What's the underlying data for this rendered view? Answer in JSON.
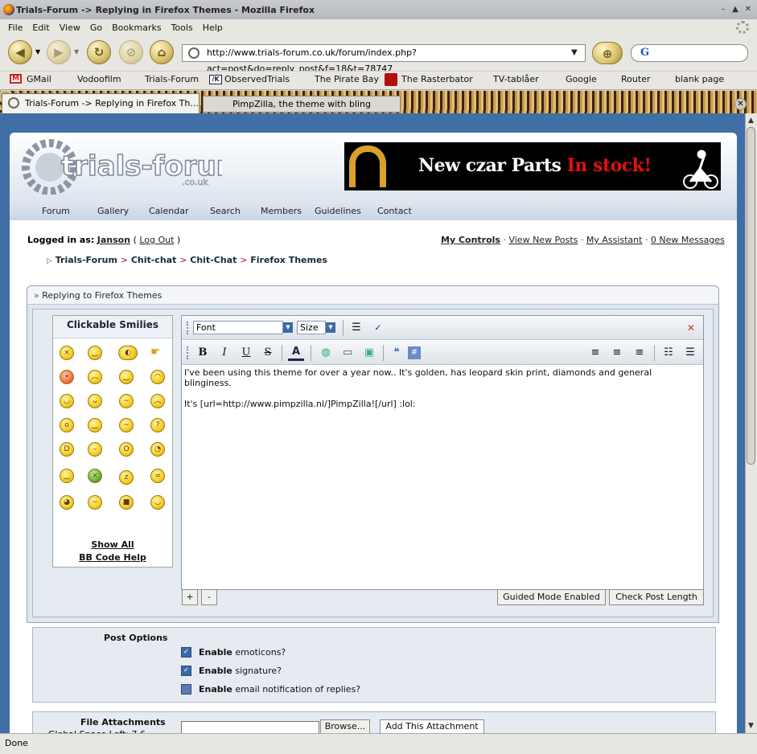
{
  "window": {
    "title": "Trials-Forum -> Replying in Firefox Themes - Mozilla Firefox",
    "min": "–",
    "max": "▲",
    "close": "✕"
  },
  "menu": [
    "File",
    "Edit",
    "View",
    "Go",
    "Bookmarks",
    "Tools",
    "Help"
  ],
  "url": "http://www.trials-forum.co.uk/forum/index.php?act=post&do=reply_post&f=18&t=78747",
  "bookmarks": [
    "GMail",
    "Vodoofilm",
    "Trials-Forum",
    "ObservedTrials",
    "The Pirate Bay",
    "The Rasterbator",
    "TV-tablåer",
    "Google",
    "Router",
    "blank page"
  ],
  "tabs": {
    "active": "Trials-Forum -> Replying in Firefox Th...",
    "inactive": "PimpZilla, the theme with bling"
  },
  "site": {
    "logo": "trials-forum",
    "logo_sub": ".co.uk",
    "banner": {
      "text": "New czar Parts ",
      "highlight": "In stock!"
    },
    "nav": [
      "Forum",
      "Gallery",
      "Calendar",
      "Search",
      "Members",
      "Guidelines",
      "Contact"
    ],
    "logged_in_label": "Logged in as:",
    "username": "Janson",
    "logout": "Log Out",
    "user_links": [
      "My Controls",
      "View New Posts",
      "My Assistant",
      "0 New Messages"
    ],
    "breadcrumb": [
      "Trials-Forum",
      "Chit-chat",
      "Chit-Chat",
      "Firefox Themes"
    ]
  },
  "reply": {
    "heading": "Replying to Firefox Themes",
    "smilies_title": "Clickable Smilies",
    "show_all": "Show All",
    "bbcode_help": "BB Code Help",
    "font": "Font",
    "size": "Size",
    "body_line1": "I've been using this theme for over a year now.. It's golden, has leopard skin print, diamonds and general blinginess.",
    "body_line2": "It's [url=http://www.pimpzilla.nl/]PimpZilla![/url] :lol:",
    "plus": "+",
    "minus": "-",
    "guided": "Guided Mode Enabled",
    "check_length": "Check Post Length"
  },
  "options": {
    "heading": "Post Options",
    "items": [
      {
        "bold": "Enable",
        "rest": " emoticons?",
        "checked": true
      },
      {
        "bold": "Enable",
        "rest": " signature?",
        "checked": true
      },
      {
        "bold": "Enable",
        "rest": " email notification of replies?",
        "checked": false
      }
    ]
  },
  "attachments": {
    "heading": "File Attachments",
    "sub": "Global Space Left: 7.6 ",
    "browse": "Browse...",
    "add": "Add This Attachment"
  },
  "status": "Done"
}
